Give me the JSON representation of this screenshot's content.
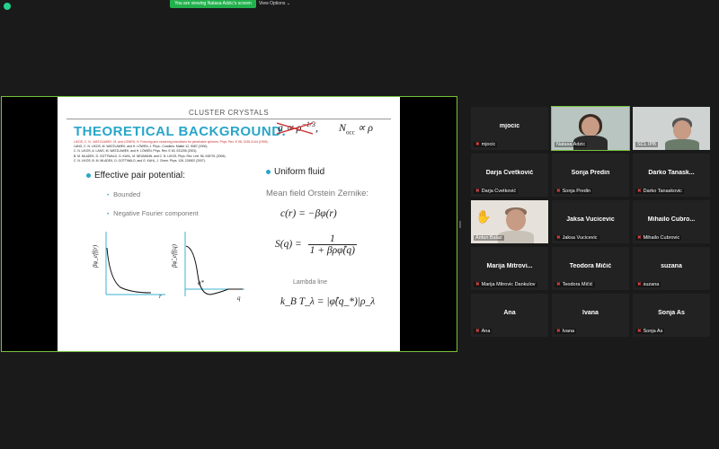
{
  "topbar": {
    "banner": "You are viewing Natasa Adzic's screen",
    "view_options": "View Options ⌄"
  },
  "slide": {
    "section_title": "CLUSTER CRYSTALS",
    "heading": "THEORETICAL BACKGROUND.",
    "refs": [
      "LIKOS, C. N., WATZLAWEK, M. and LÖWEN, H. Freezing and clustering transitions  for penetrable spheres. Phys. Rev. E 58, 3135-3144 (1998).",
      "LANG, C. N. LIKOS, M. WATZLAWEK, and H. LÖWEN, J. Phys.: Condens. Matter 12, 5087 (2000).",
      "C. N. LIKOS, A. LANG, M. WATZLAWEK, and H. LÖWEN, Phys. Rev. E 63, 031206 (2001).",
      "B. M. MLADEK, D. GOTTWALD, G. KAHL, M. NEUMANN, and C. N. LIKOS, Phys. Rev. Lett. 96, 045701 (2006).",
      "C. N. LIKOS, B. M. MLADEK, D. GOTTWALD, and G. KAHL, J. Chem. Phys. 126, 224502 (2007)."
    ],
    "formula_a": "a ∝ ρ",
    "formula_exp": "−1/3",
    "formula_n": "N",
    "formula_n_sub": "occ",
    "formula_n_rest": " ∝ ρ",
    "effective_pair": "Effective pair potential:",
    "bounded": "Bounded",
    "neg_fourier": "Negative Fourier component",
    "uniform_fluid": "Uniform fluid",
    "mean_field": "Mean field Orstein Zernike:",
    "eq_c": "c(r) = −βφ(r)",
    "eq_s_lhs": "S(q) =",
    "eq_s_num": "1",
    "eq_s_den": "1 + βρφ̂(q)",
    "lambda_line": "Lambda line",
    "eq_k": "k_B T_λ = |φ̂(q_*)|ρ_λ",
    "g1_ylabel": "βφ_eff(r)",
    "g1_xlabel": "r",
    "g2_ylabel": "βφ̂_eff(q)",
    "g2_xlabel": "q",
    "g2_qstar": "q*"
  },
  "participants": [
    {
      "big": "mjocic",
      "name": "mjocic",
      "video": false
    },
    {
      "big": "",
      "name": "Natasa Adzic",
      "video": true
    },
    {
      "big": "",
      "name": "SCL IPB",
      "video": true
    },
    {
      "big": "Darja Cvetković",
      "name": "Darja Cvetković",
      "video": false
    },
    {
      "big": "Sonja Predin",
      "name": "Sonja Predin",
      "video": false
    },
    {
      "big": "Darko Tanask...",
      "name": "Darko Tanaskovic",
      "video": false
    },
    {
      "big": "",
      "name": "Antun Balaz",
      "video": true
    },
    {
      "big": "Jaksa Vucicevic",
      "name": "Jaksa Vucicevic",
      "video": false
    },
    {
      "big": "Mihailo Cubro...",
      "name": "Mihailo Cubrovic",
      "video": false
    },
    {
      "big": "Marija Mitrovi...",
      "name": "Marija Mitrovic Dankulov",
      "video": false
    },
    {
      "big": "Teodora Mičić",
      "name": "Teodora Mičić",
      "video": false
    },
    {
      "big": "suzana",
      "name": "suzana",
      "video": false
    },
    {
      "big": "Ana",
      "name": "Ana",
      "video": false
    },
    {
      "big": "Ivana",
      "name": "Ivana",
      "video": false
    },
    {
      "big": "Sonja As",
      "name": "Sonja As",
      "video": false
    }
  ],
  "colors": {
    "accent": "#76c23b",
    "banner": "#22b14c",
    "slide_heading": "#29a6c8"
  },
  "icons": {
    "shield": "shield-icon",
    "mic": "mic-muted-icon",
    "hand": "raised-hand-icon"
  }
}
